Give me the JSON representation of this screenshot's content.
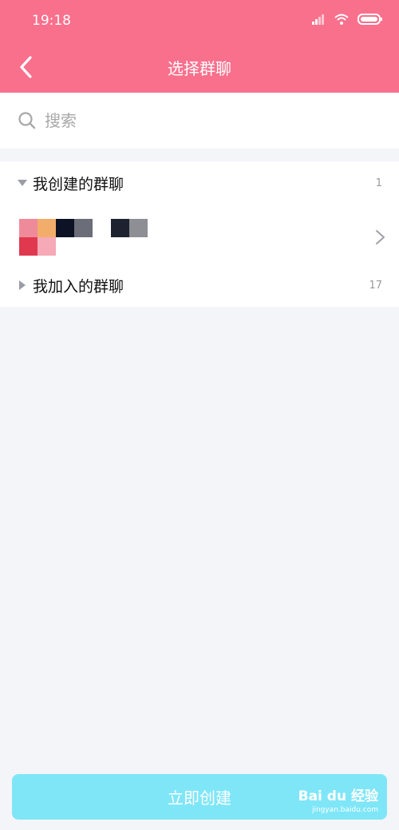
{
  "status_bar": {
    "time": "19:18",
    "icons": [
      "signal-icon",
      "wifi-icon",
      "battery-icon"
    ]
  },
  "nav": {
    "title": "选择群聊",
    "back_icon": "back-arrow-icon"
  },
  "search": {
    "placeholder": "搜索",
    "icon": "search-icon"
  },
  "groups": [
    {
      "title": "我创建的群聊",
      "count": "1",
      "expanded": true
    },
    {
      "title": "我加入的群聊",
      "count": "17",
      "expanded": false
    }
  ],
  "created_group_row": {
    "avatar_colors": [
      "#ef8a9a",
      "#f3ad6b",
      "#0d1224",
      "#6b6e78",
      "#1e2230",
      "#8e8f95",
      "#e0394f",
      "#f6a9b7"
    ],
    "chevron_icon": "chevron-right-icon"
  },
  "bottom_button": {
    "label": "立即创建",
    "color": "#7fe6f8"
  },
  "watermark": {
    "main": "Bai du 经验",
    "sub": "jingyan.baidu.com"
  },
  "colors": {
    "accent": "#f9708d",
    "background": "#f4f5f9"
  }
}
